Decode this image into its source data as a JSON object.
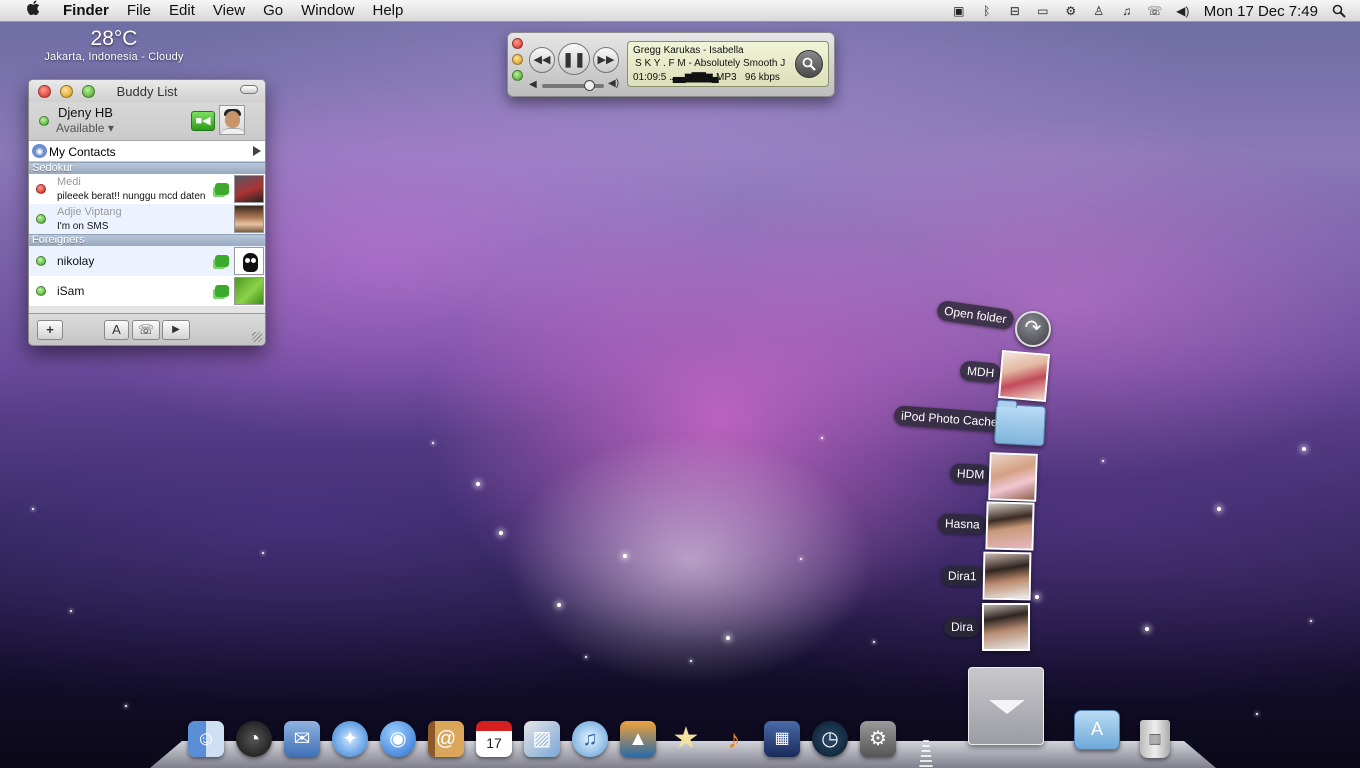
{
  "menubar": {
    "apple": "",
    "app": "Finder",
    "menus": [
      "File",
      "Edit",
      "View",
      "Go",
      "Window",
      "Help"
    ],
    "clock": "Mon 17 Dec 7:49",
    "status_icons": [
      "display-icon",
      "bluetooth-icon",
      "network-icon",
      "screen-icon",
      "gear-icon",
      "user-icon",
      "music-note-icon",
      "phone-icon",
      "volume-icon",
      "spotlight-icon"
    ]
  },
  "weather": {
    "temp": "28°C",
    "location": "Jakarta, Indonesia - Cloudy"
  },
  "buddy_list": {
    "title": "Buddy List",
    "me": {
      "name": "Djeny HB",
      "status": "Available ▾"
    },
    "contacts_label": "My Contacts",
    "groups": [
      {
        "name": "Sedokur",
        "buddies": [
          {
            "name": "Medi",
            "message": "pileeek berat!! nunggu mcd daten",
            "status": "red"
          },
          {
            "name": "Adjie Viptang",
            "message": "I'm on SMS",
            "status": "green"
          }
        ]
      },
      {
        "name": "Foreigners",
        "buddies": [
          {
            "name": "nikolay",
            "message": "",
            "status": "green"
          },
          {
            "name": "iSam",
            "message": "",
            "status": "green"
          }
        ]
      }
    ],
    "footer": {
      "add": "+",
      "text": "A",
      "audio": "☏",
      "video": "▶"
    }
  },
  "player": {
    "artist_title": "Gregg Karukas - Isabella",
    "station": "S K Y . F M - Absolutely Smooth J",
    "time": "01:09:5",
    "bars": "..▄▄▆▇▇▆▄.",
    "format": "MP3",
    "bitrate": "96 kbps",
    "volume": 0.75
  },
  "stack": {
    "open_label": "Open folder",
    "items": [
      "MDH",
      "iPod Photo Cache",
      "HDM",
      "Hasna",
      "Dira1",
      "Dira"
    ]
  },
  "dock": {
    "items": [
      "Finder",
      "Dashboard",
      "Mail",
      "Safari",
      "iChat",
      "Address Book",
      "iCal",
      "Preview",
      "iTunes",
      "iPhoto",
      "iMovie",
      "GarageBand",
      "Spaces",
      "Time Machine",
      "System Preferences"
    ],
    "ical_date": "17",
    "ical_month": "DEC"
  }
}
